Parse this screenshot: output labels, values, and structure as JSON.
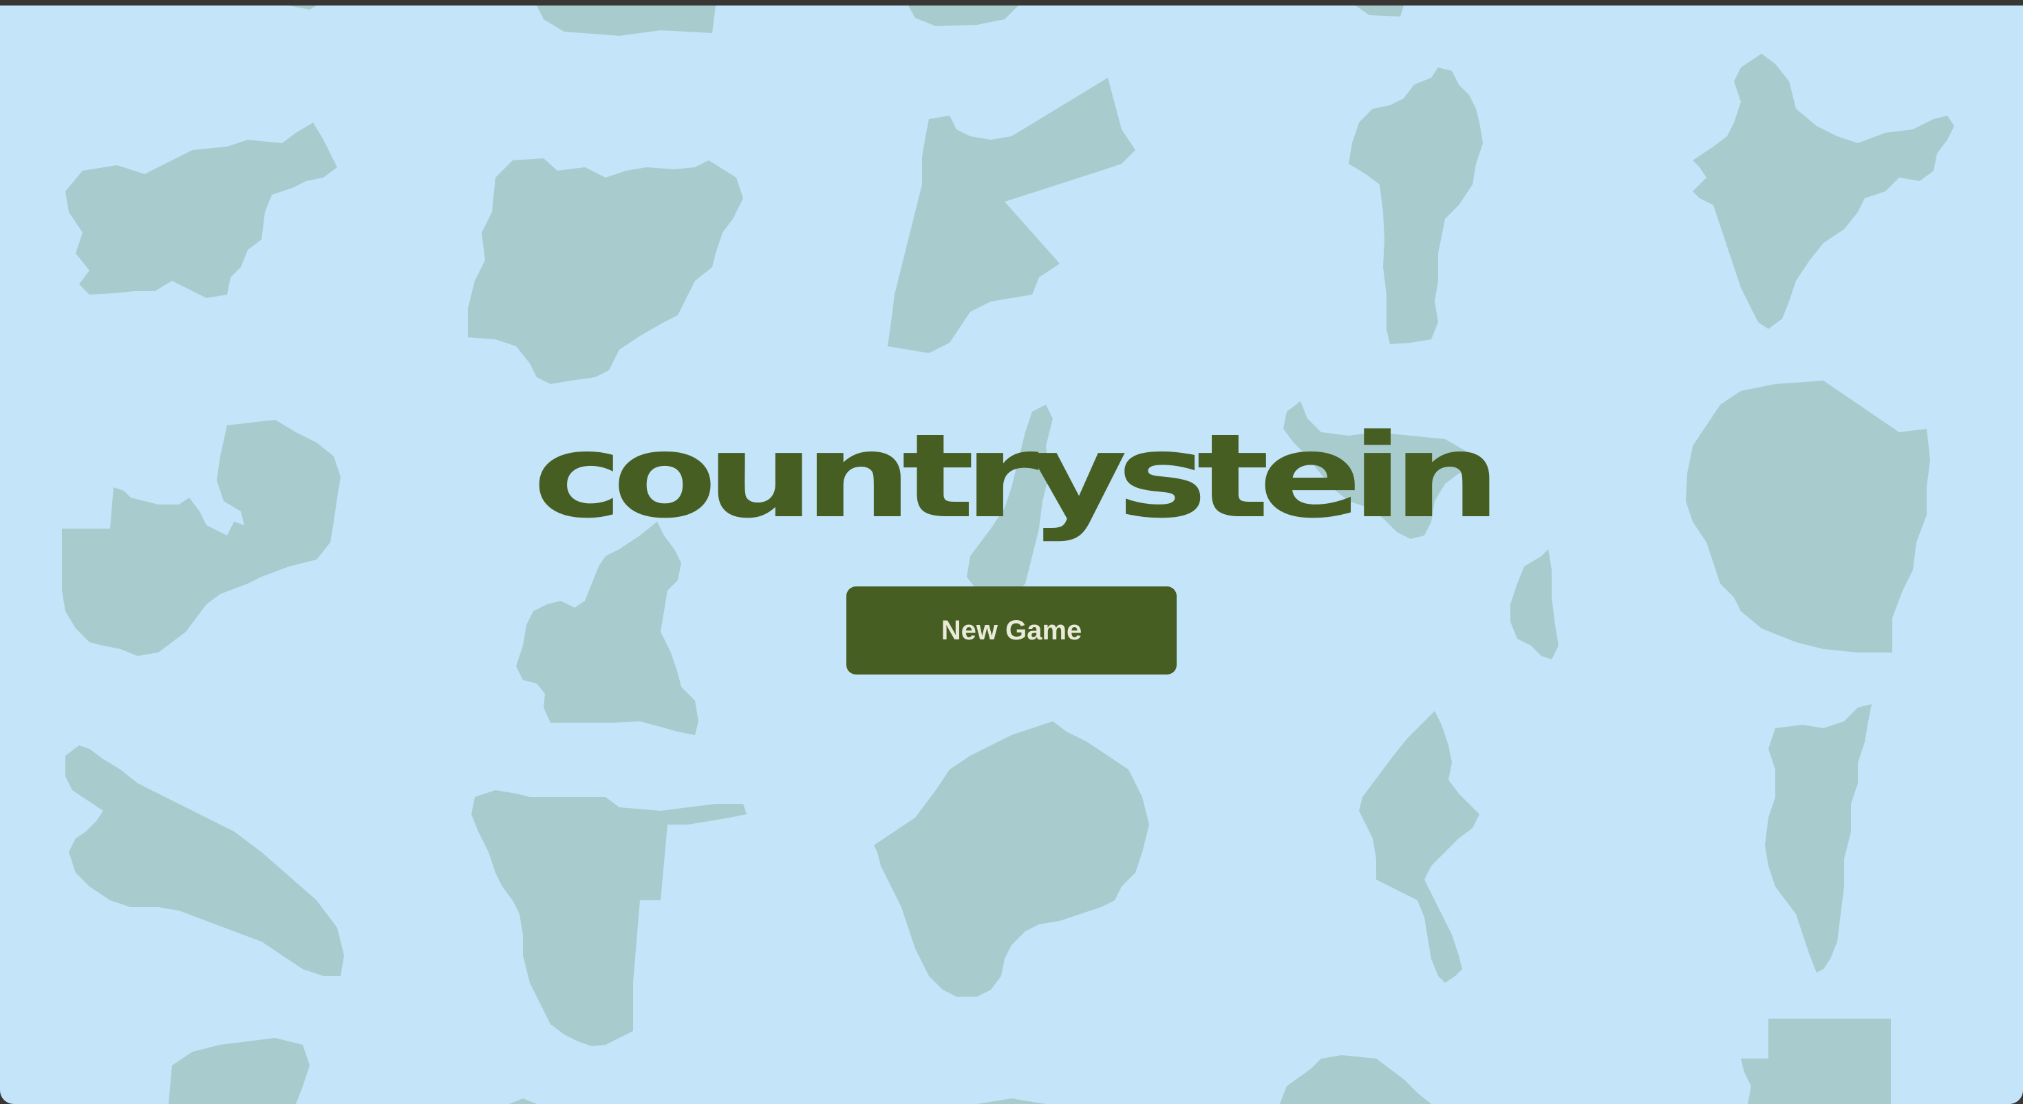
{
  "app": {
    "title": "countrystein"
  },
  "menu": {
    "new_game_label": "New Game"
  },
  "background": {
    "decoration": "country-silhouettes"
  },
  "colors": {
    "background": "#c3e4f9",
    "silhouette": "#a8cbce",
    "accent": "#465e21",
    "button_text": "#e9ead9",
    "top_bar": "#3a3634"
  }
}
